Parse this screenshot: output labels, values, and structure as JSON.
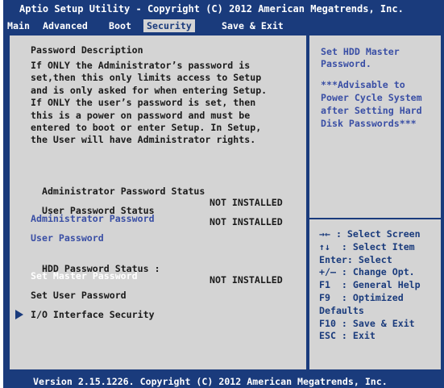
{
  "title": "Aptio Setup Utility - Copyright (C) 2012 American Megatrends, Inc.",
  "menu": {
    "main": "Main",
    "advanced": "Advanced",
    "boot": "Boot",
    "security": "Security",
    "save_exit": "Save & Exit"
  },
  "description": {
    "title": "Password Description",
    "body": "If ONLY the Administrator’s password is\nset,then this only limits access to Setup\nand is only asked for when entering Setup.\nIf ONLY the user’s password is set, then\nthis is a power on password and must be\nentered to boot or enter Setup. In Setup,\nthe User will have Administrator rights."
  },
  "items": {
    "admin_status_label": "Administrator Password Status",
    "admin_status_value": "NOT INSTALLED",
    "user_status_label": "User Password Status",
    "user_status_value": "NOT INSTALLED",
    "admin_password": "Administrator Password",
    "user_password": "User Password",
    "hdd_status_label": "HDD Password Status :",
    "hdd_status_value": "NOT INSTALLED",
    "set_master_password": "Set Master Password",
    "set_user_password": "Set User Password",
    "io_interface_security": "I/O Interface Security"
  },
  "help": {
    "line1": "Set HDD Master\nPassword.",
    "line2": "***Advisable to\nPower Cycle System\nafter Setting Hard\nDisk Passwords***"
  },
  "keys": "→← : Select Screen\n↑↓  : Select Item\nEnter: Select\n+/— : Change Opt.\nF1  : General Help\nF9  : Optimized\nDefaults\nF10 : Save & Exit\nESC : Exit",
  "footer": "Version 2.15.1226. Copyright (C) 2012 American Megatrends, Inc.",
  "colors": {
    "frame": "#1a3b7c",
    "panel": "#d4d4d4",
    "link": "#3a4fa5"
  }
}
